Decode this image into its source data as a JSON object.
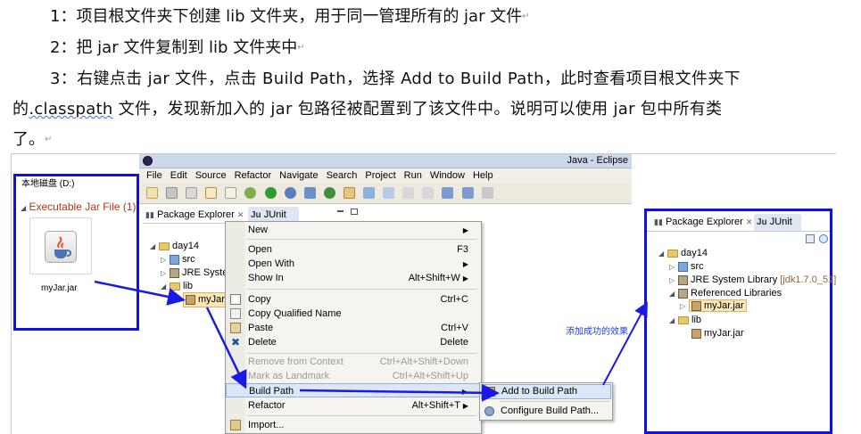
{
  "doc": {
    "line1": "1：项目根文件夹下创建 lib 文件夹，用于同一管理所有的 jar 文件",
    "line2": "2：把 jar 文件复制到 lib 文件夹中",
    "line3": "3：右键点击 jar 文件，点击 Build Path，选择 Add to Build Path，此时查看项目根文件夹下",
    "line4a": "的",
    "line4b": ".classpath",
    "line4c": " 文件，发现新加入的 jar 包路径被配置到了该文件中。说明可以使用 jar 包中所有类",
    "line5": "了。"
  },
  "disk": {
    "drive_label": "本地磁盘 (D:)",
    "group_title": "Executable Jar File (1)",
    "file_name": "myJar.jar"
  },
  "eclipse": {
    "title": "Java - Eclipse",
    "menus": [
      "File",
      "Edit",
      "Source",
      "Refactor",
      "Navigate",
      "Search",
      "Project",
      "Run",
      "Window",
      "Help"
    ],
    "tab_package_explorer": "Package Explorer",
    "tab_junit": "JUnit",
    "tree": {
      "project": "day14",
      "src": "src",
      "jre": "JRE Syster",
      "lib": "lib",
      "jar": "myJar.ja"
    }
  },
  "context_menu": {
    "items": [
      {
        "label": "New",
        "shortcut": ""
      },
      {
        "label": "Open",
        "shortcut": "F3"
      },
      {
        "label": "Open With",
        "shortcut": ""
      },
      {
        "label": "Show In",
        "shortcut": "Alt+Shift+W"
      },
      {
        "label": "Copy",
        "shortcut": "Ctrl+C"
      },
      {
        "label": "Copy Qualified Name",
        "shortcut": ""
      },
      {
        "label": "Paste",
        "shortcut": "Ctrl+V"
      },
      {
        "label": "Delete",
        "shortcut": "Delete"
      },
      {
        "label": "Remove from Context",
        "shortcut": "Ctrl+Alt+Shift+Down"
      },
      {
        "label": "Mark as Landmark",
        "shortcut": "Ctrl+Alt+Shift+Up"
      },
      {
        "label": "Build Path",
        "shortcut": ""
      },
      {
        "label": "Refactor",
        "shortcut": "Alt+Shift+T"
      },
      {
        "label": "Import...",
        "shortcut": ""
      }
    ],
    "submenu": {
      "add": "Add to Build Path",
      "configure": "Configure Build Path..."
    }
  },
  "annotation": "添加成功的效果",
  "result": {
    "tab_package_explorer": "Package Explorer",
    "tab_junit": "JUnit",
    "tree": {
      "project": "day14",
      "src": "src",
      "jre": "JRE System Library",
      "jre_version": "[jdk1.7.0_51]",
      "ref": "Referenced Libraries",
      "ref_jar": "myJar.jar",
      "lib": "lib",
      "lib_jar": "myJar.jar"
    }
  },
  "colors": {
    "highlight_frame": "#1010e0",
    "arrow": "#1a1ae6",
    "eclipse_title_bar": "#cdd8ea",
    "menu_bg": "#f5f4f0",
    "selected_item": "#dbe6f7"
  }
}
